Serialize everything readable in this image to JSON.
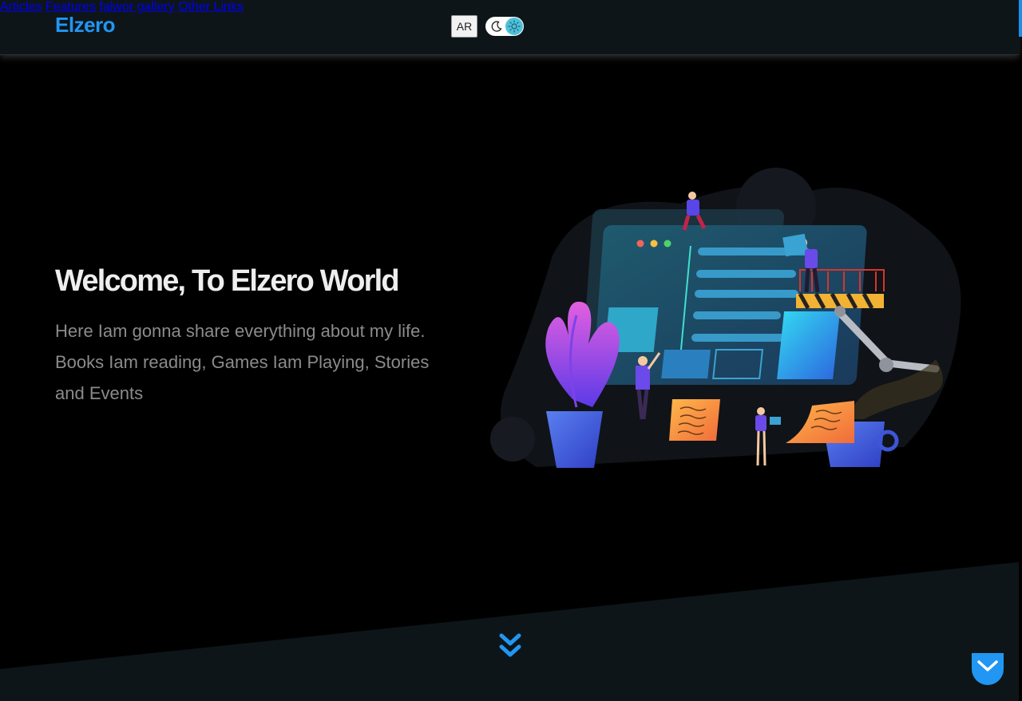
{
  "header": {
    "logo": "Elzero",
    "lang_button": "AR",
    "theme_toggle": {
      "state": "dark"
    },
    "nav": [
      {
        "label": "Articles"
      },
      {
        "label": "Features"
      },
      {
        "label": "falwor gallery"
      },
      {
        "label": "Other Links"
      }
    ]
  },
  "hero": {
    "title": "Welcome, To Elzero World",
    "description": "Here Iam gonna share everything about my life. Books Iam reading, Games Iam Playing, Stories and Events",
    "illustration": "team-building-website-illustration"
  },
  "scroll_down": {
    "icon": "double-chevron-down-icon"
  },
  "scroll_top": {
    "icon": "chevron-down-icon"
  },
  "colors": {
    "accent": "#2196f3",
    "header_bg": "#0d1519",
    "page_bg": "#000000",
    "section_bg": "#0d1519",
    "text_muted": "#8b8b8b",
    "title_text": "#eeeeee"
  }
}
